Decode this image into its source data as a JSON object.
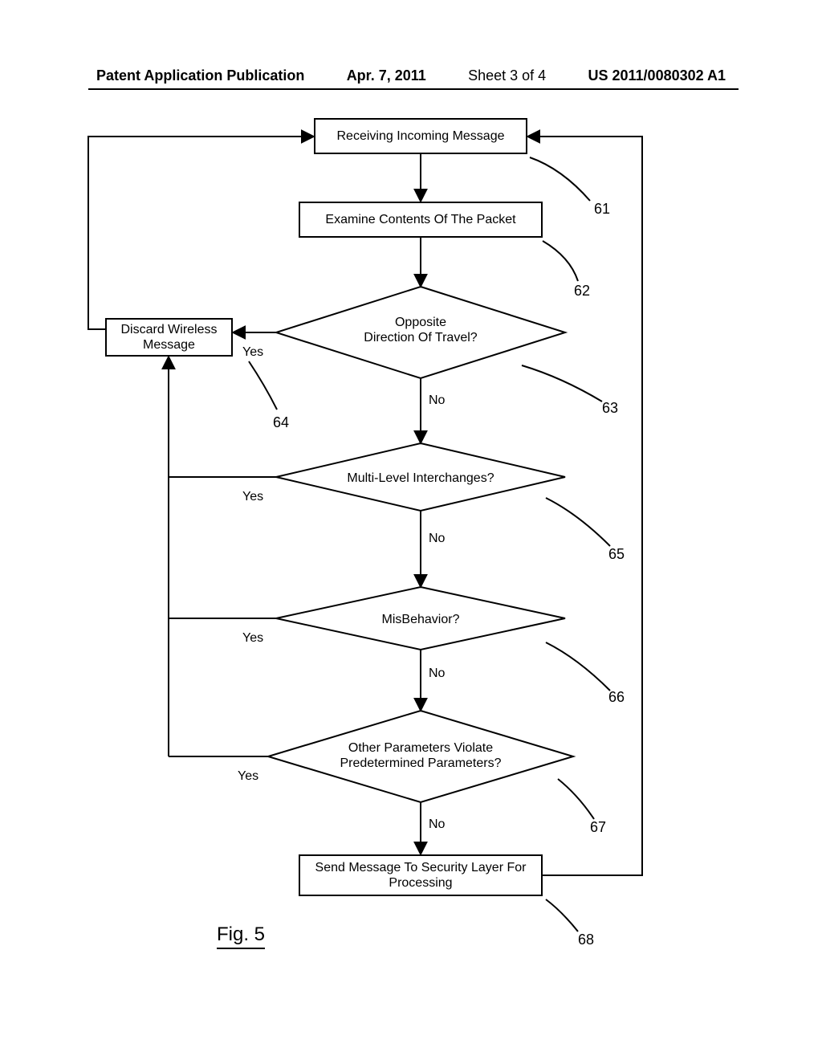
{
  "header": {
    "publication": "Patent Application Publication",
    "date": "Apr. 7, 2011",
    "sheet": "Sheet 3 of 4",
    "pubnum": "US 2011/0080302 A1"
  },
  "nodes": {
    "discard": "Discard Wireless\nMessage",
    "n61": "Receiving Incoming Message",
    "n62": "Examine Contents Of The Packet",
    "n63": "Opposite\nDirection Of Travel?",
    "n65": "Multi-Level Interchanges?",
    "n66": "MisBehavior?",
    "n67": "Other Parameters Violate\nPredetermined Parameters?",
    "n68": "Send Message To Security Layer For\nProcessing"
  },
  "edge_labels": {
    "yes": "Yes",
    "no": "No"
  },
  "refs": {
    "r61": "61",
    "r62": "62",
    "r63": "63",
    "r64": "64",
    "r65": "65",
    "r66": "66",
    "r67": "67",
    "r68": "68"
  },
  "figure_label": "Fig. 5"
}
